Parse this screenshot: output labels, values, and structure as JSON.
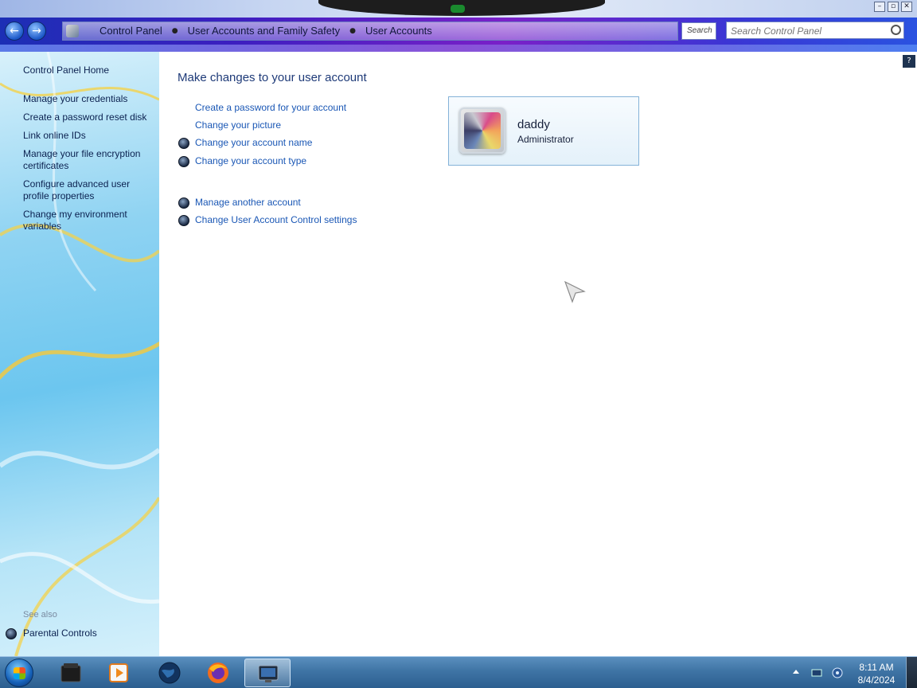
{
  "window": {
    "controls": {
      "minimize": "–",
      "maximize": "▫",
      "close": "✕"
    }
  },
  "address_bar": {
    "back_icon": "back-arrow-icon",
    "forward_icon": "forward-arrow-icon",
    "breadcrumbs": [
      "Control Panel",
      "User Accounts and Family Safety",
      "User Accounts"
    ],
    "refresh_box_text": "Search",
    "search_placeholder": "Search Control Panel"
  },
  "nav": {
    "home": "Control Panel Home",
    "links": [
      "Manage your credentials",
      "Create a password reset disk",
      "Link online IDs",
      "Manage your file encryption certificates",
      "Configure advanced user profile properties",
      "Change my environment variables"
    ],
    "see_also_label": "See also",
    "see_also_links": [
      "Parental Controls"
    ]
  },
  "main": {
    "help_label": "?",
    "title": "Make changes to your user account",
    "tasks_group1": [
      {
        "label": "Create a password for your account",
        "shield": false
      },
      {
        "label": "Change your picture",
        "shield": false
      },
      {
        "label": "Change your account name",
        "shield": true
      },
      {
        "label": "Change your account type",
        "shield": true
      }
    ],
    "tasks_group2": [
      {
        "label": "Manage another account",
        "shield": true
      },
      {
        "label": "Change User Account Control settings",
        "shield": true
      }
    ],
    "account": {
      "name": "daddy",
      "role": "Administrator"
    }
  },
  "taskbar": {
    "start_icon": "windows-start-orb-icon",
    "pinned": [
      {
        "name": "file-manager-icon",
        "active": false
      },
      {
        "name": "media-player-icon",
        "active": false
      },
      {
        "name": "globe-browser-icon",
        "active": false
      },
      {
        "name": "firefox-icon",
        "active": false
      },
      {
        "name": "control-panel-window-icon",
        "active": true
      }
    ],
    "clock": {
      "time": "8:11 AM",
      "date": "8/4/2024"
    }
  },
  "colors": {
    "link": "#1a57b5",
    "title": "#1e3a78",
    "nav_text": "#0b2150",
    "card_border": "#84b2d8"
  }
}
